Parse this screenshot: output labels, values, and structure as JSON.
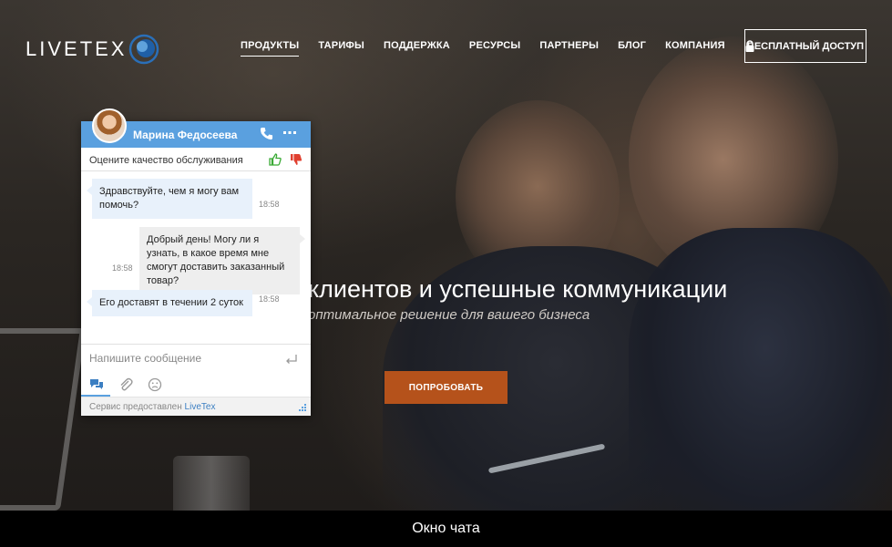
{
  "header": {
    "logo_text": "LIVETEX",
    "nav": [
      {
        "label": "ПРОДУКТЫ"
      },
      {
        "label": "ТАРИФЫ"
      },
      {
        "label": "ПОДДЕРЖКА"
      },
      {
        "label": "РЕСУРСЫ"
      },
      {
        "label": "ПАРТНЕРЫ"
      },
      {
        "label": "БЛОГ"
      },
      {
        "label": "КОМПАНИЯ"
      }
    ],
    "active_nav": "ПРОДУКТЫ",
    "lock_icon": "lock-icon",
    "cta_label": "БЕСПЛАТНЫЙ ДОСТУП"
  },
  "hero": {
    "title": "клиентов и успешные коммуникации",
    "subtitle": "оптимальное решение для вашего бизнеса",
    "button_label": "ПОПРОБОВАТЬ",
    "button_color": "#b5521b"
  },
  "chat": {
    "agent_name": "Марина Федосеева",
    "header_color": "#5aa0df",
    "rate_prompt": "Оцените качество обслуживания",
    "messages": [
      {
        "from": "agent",
        "text": "Здравствуйте, чем я могу вам помочь?",
        "time": "18:58"
      },
      {
        "from": "user",
        "text": "Добрый день! Могу ли я узнать, в какое время мне смогут доставить заказанный товар?",
        "time": "18:58"
      },
      {
        "from": "agent",
        "text": "Его доставят в течении 2 суток",
        "time": "18:58"
      }
    ],
    "input_placeholder": "Напишите сообщение",
    "footer_prefix": "Сервис предоставлен ",
    "footer_brand": "LiveTex",
    "icons": [
      "phone-icon",
      "more-icon",
      "thumb-up-icon",
      "thumb-down-icon",
      "enter-icon",
      "chat-bubbles-icon",
      "paperclip-icon",
      "sad-face-icon",
      "resize-icon"
    ]
  },
  "caption": "Окно чата"
}
